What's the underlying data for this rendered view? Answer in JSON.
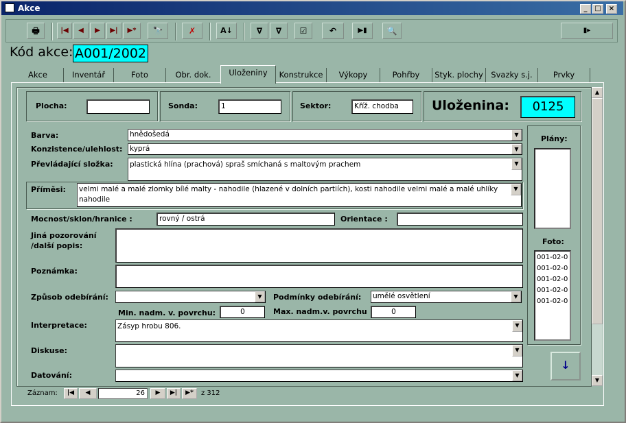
{
  "window": {
    "title": "Akce",
    "min": "_",
    "max": "□",
    "close": "×"
  },
  "toolbar": {
    "print": "🖶",
    "first": "|◀",
    "prev": "◀",
    "next": "▶",
    "last": "▶|",
    "new": "▶*",
    "find": "🔭",
    "delete": "✗",
    "sort": "A↓",
    "filter_form": "∇",
    "filter": "∇",
    "check": "☑",
    "undo": "↶",
    "go": "▶▮",
    "zoom": "🔍",
    "exit": "▮▸"
  },
  "kod": {
    "label": "Kód akce:",
    "value": "A001/2002"
  },
  "tabs": [
    "Akce",
    "Inventář",
    "Foto",
    "Obr. dok.",
    "Uloženiny",
    "Konstrukce",
    "Výkopy",
    "Pohřby",
    "Styk. plochy",
    "Svazky s.j.",
    "Prvky"
  ],
  "header": {
    "plocha_label": "Plocha:",
    "plocha_value": "",
    "sonda_label": "Sonda:",
    "sonda_value": "1",
    "sektor_label": "Sektor:",
    "sektor_value": "Kříž. chodba",
    "ulozenina_label": "Uloženina:",
    "ulozenina_value": "0125"
  },
  "fields": {
    "barva_label": "Barva:",
    "barva_value": "hnědošedá",
    "konz_label": "Konzistence/ulehlost:",
    "konz_value": "kyprá",
    "prevl_label": "Převládající složka:",
    "prevl_value": "plastická hlína (prachová) spraš smíchaná s maltovým prachem",
    "primesi_label": "Příměsi:",
    "primesi_value": "velmi malé a malé zlomky bílé malty - nahodile (hlazené v dolních partiích), kosti nahodile velmi malé a malé uhlíky nahodile",
    "mocnost_label": "Mocnost/sklon/hranice :",
    "mocnost_value": "rovný / ostrá",
    "orientace_label": "Orientace :",
    "orientace_value": "",
    "jina_label": "Jiná pozorování /další popis:",
    "jina_value": "",
    "poznamka_label": "Poznámka:",
    "poznamka_value": "",
    "zpusob_label": "Způsob odebírání:",
    "zpusob_value": "",
    "podminky_label": "Podmínky odebírání:",
    "podminky_value": "umělé osvětlení",
    "min_label": "Min. nadm. v. povrchu:",
    "min_value": "0",
    "max_label": "Max. nadm.v. povrchu",
    "max_value": "0",
    "interpretace_label": "Interpretace:",
    "interpretace_value": "Zásyp hrobu 806.",
    "diskuse_label": "Diskuse:",
    "diskuse_value": "",
    "datovani_label": "Datování:",
    "datovani_value": ""
  },
  "side": {
    "plany_label": "Plány:",
    "foto_label": "Foto:",
    "foto_items": [
      "001-02-0",
      "001-02-0",
      "001-02-0",
      "001-02-0",
      "001-02-0"
    ],
    "down_arrow": "↓"
  },
  "nav": {
    "label": "Záznam:",
    "current": "26",
    "total": "z 312",
    "first": "|◀",
    "prev": "◀",
    "next": "▶",
    "last": "▶|",
    "new": "▶*"
  }
}
